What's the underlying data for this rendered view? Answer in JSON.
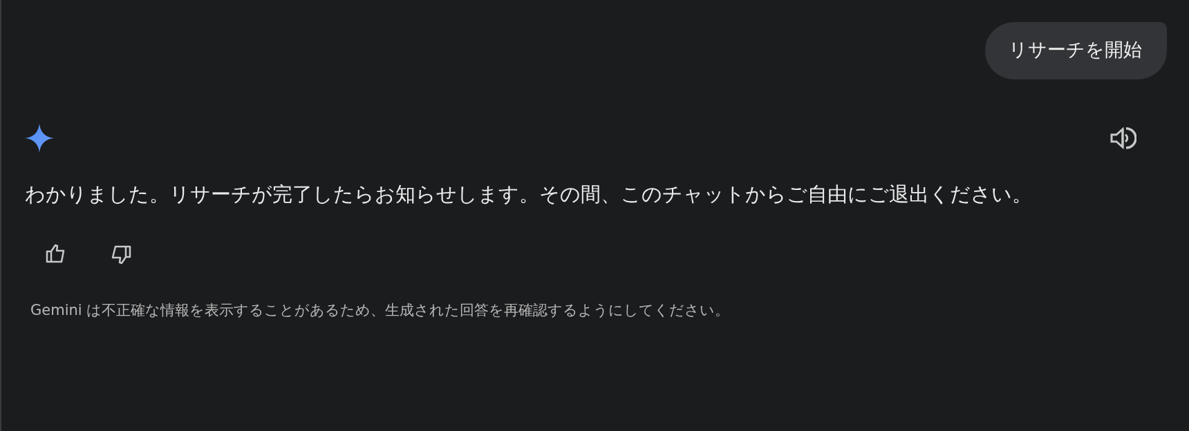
{
  "user_message": {
    "text": "リサーチを開始"
  },
  "response": {
    "text": "わかりました。リサーチが完了したらお知らせします。その間、このチャットからご自由にご退出ください。"
  },
  "disclaimer": "Gemini は不正確な情報を表示することがあるため、生成された回答を再確認するようにしてください。"
}
